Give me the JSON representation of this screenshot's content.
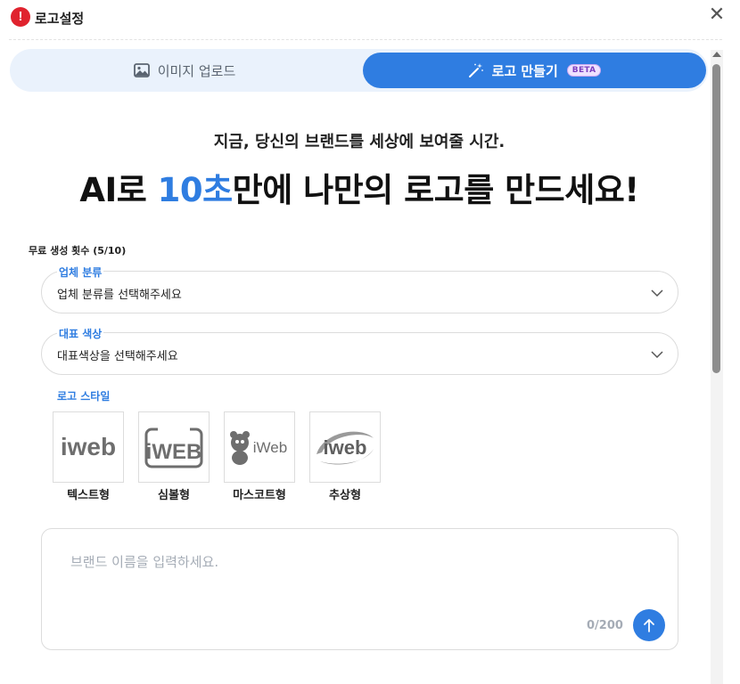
{
  "window": {
    "title": "로고설정",
    "close_label": "✕"
  },
  "tabs": [
    {
      "label": "이미지 업로드",
      "icon": "image-icon",
      "active": false
    },
    {
      "label": "로고 만들기",
      "icon": "magic-wand-icon",
      "active": true,
      "badge": "BETA"
    }
  ],
  "hero": {
    "subheading": "지금, 당신의 브랜드를 세상에 보여줄 시간.",
    "headline_prefix": "AI로 ",
    "headline_highlight": "10초",
    "headline_suffix": "만에 나만의 로고를 만드세요!"
  },
  "usage": {
    "counter": "무료 생성 횟수 (5/10)"
  },
  "fields": {
    "industry": {
      "label": "업체 분류",
      "placeholder": "업체 분류를 선택해주세요"
    },
    "color": {
      "label": "대표 색상",
      "placeholder": "대표색상을 선택해주세요"
    }
  },
  "style": {
    "label": "로고 스타일",
    "options": [
      {
        "name": "텍스트형",
        "logo_text": "iweb"
      },
      {
        "name": "심볼형",
        "logo_text": "iWEB"
      },
      {
        "name": "마스코트형",
        "logo_text": "iWeb"
      },
      {
        "name": "추상형",
        "logo_text": "iweb"
      }
    ]
  },
  "prompt": {
    "placeholder": "브랜드 이름을 입력하세요.",
    "char_count": "0/200"
  },
  "colors": {
    "accent": "#2f7de1",
    "tab_track": "#eaf2fc",
    "warning": "#e0232e"
  }
}
